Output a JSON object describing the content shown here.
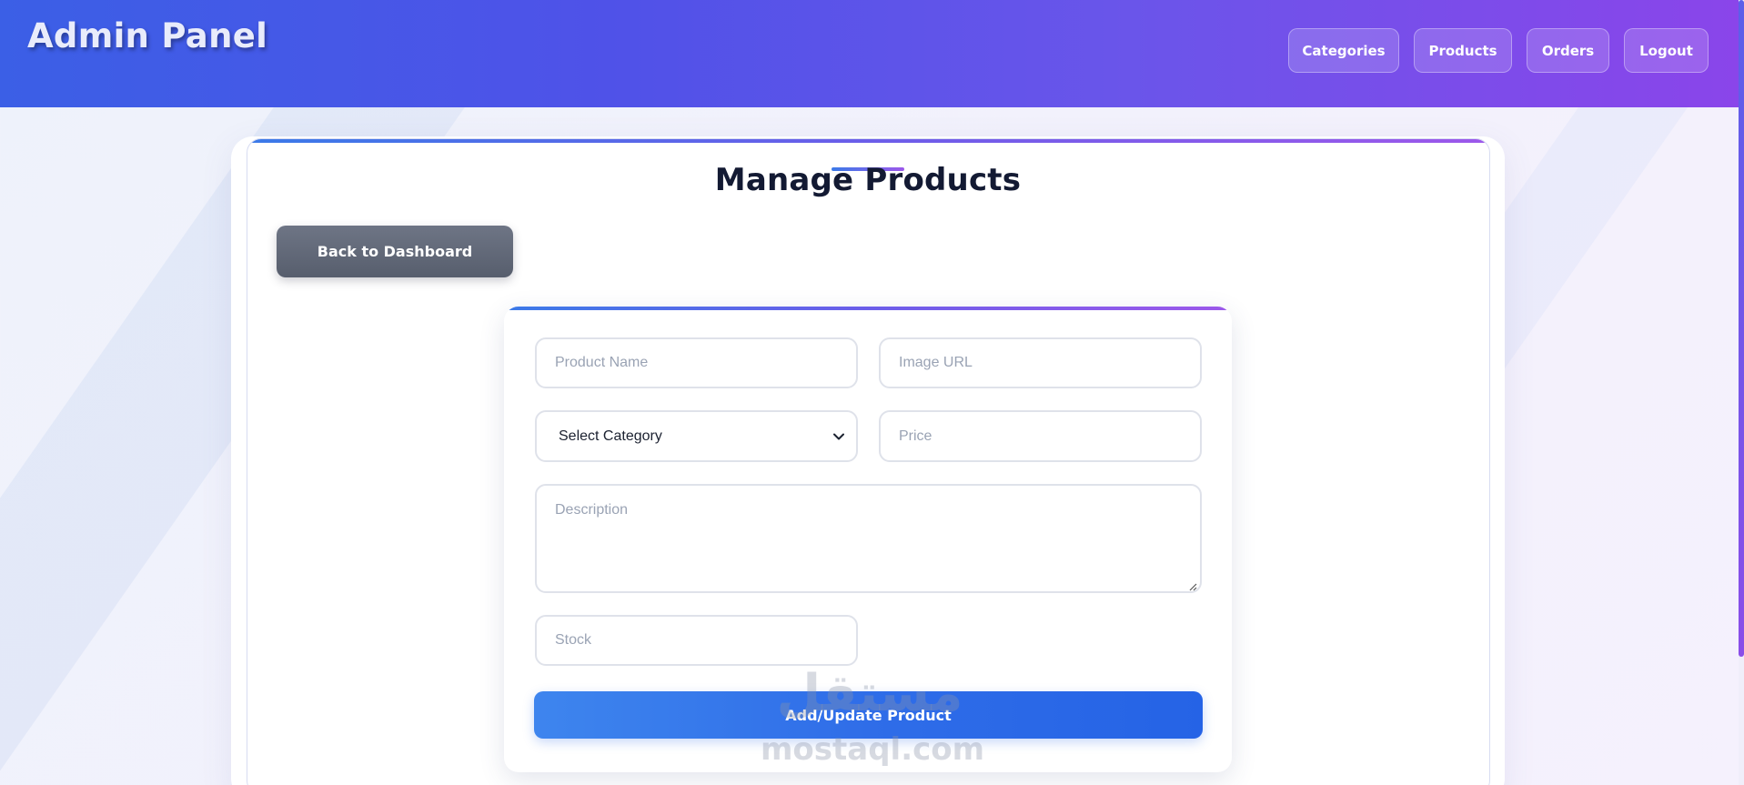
{
  "header": {
    "brand": "Admin Panel",
    "nav": [
      {
        "label": "Categories"
      },
      {
        "label": "Products"
      },
      {
        "label": "Orders"
      },
      {
        "label": "Logout"
      }
    ]
  },
  "page": {
    "title": "Manage Products",
    "back_label": "Back to Dashboard"
  },
  "form": {
    "name_placeholder": "Product Name",
    "image_placeholder": "Image URL",
    "category_selected": "Select Category",
    "price_placeholder": "Price",
    "description_placeholder": "Description",
    "stock_placeholder": "Stock",
    "submit_label": "Add/Update Product"
  },
  "watermark": {
    "arabic": "مستقل",
    "site": "mostaql.com"
  },
  "colors": {
    "header_start": "#3b5fe6",
    "header_end": "#8a45ea",
    "primary": "#2f6de8",
    "back_button": "#626978"
  },
  "icons": {
    "select_caret": "chevron-down-icon",
    "textarea_resize": "resize-grip-icon"
  }
}
